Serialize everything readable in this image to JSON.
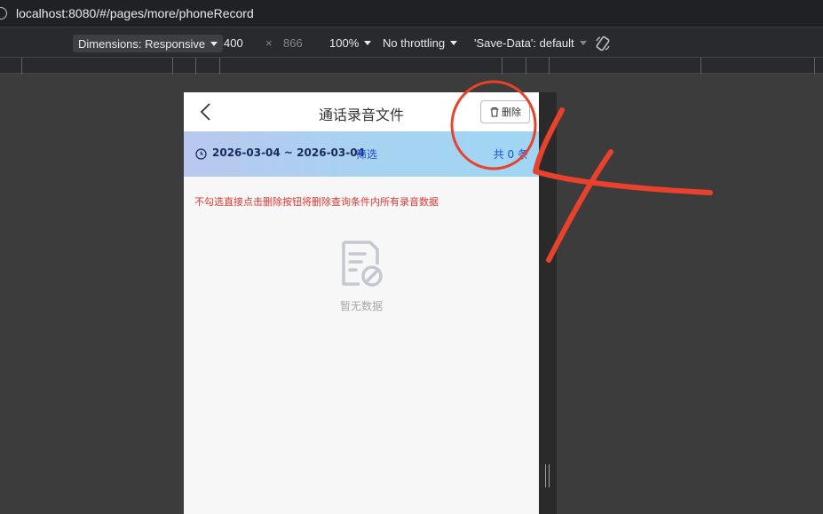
{
  "browser": {
    "url": "localhost:8080/#/pages/more/phoneRecord"
  },
  "devtools": {
    "dimensions_label": "Dimensions: Responsive",
    "width": "400",
    "times": "×",
    "height": "866",
    "zoom": "100%",
    "throttling": "No throttling",
    "save_data": "'Save-Data': default"
  },
  "page": {
    "title": "通话录音文件",
    "delete_label": "删除",
    "date_range": "2026-03-04 ~ 2026-03-04",
    "filter_label": "筛选",
    "total_label": "共 0 条",
    "tip": "不勾选直接点击删除按钮将删除查询条件内所有录音数据",
    "empty_text": "暂无数据"
  },
  "colors": {
    "annotation": "#e8412c",
    "link": "#1d4fe0",
    "tip": "#e53935"
  },
  "icons": [
    "back-arrow-icon",
    "trash-icon",
    "clock-icon",
    "no-data-document-icon",
    "rotate-device-icon"
  ]
}
